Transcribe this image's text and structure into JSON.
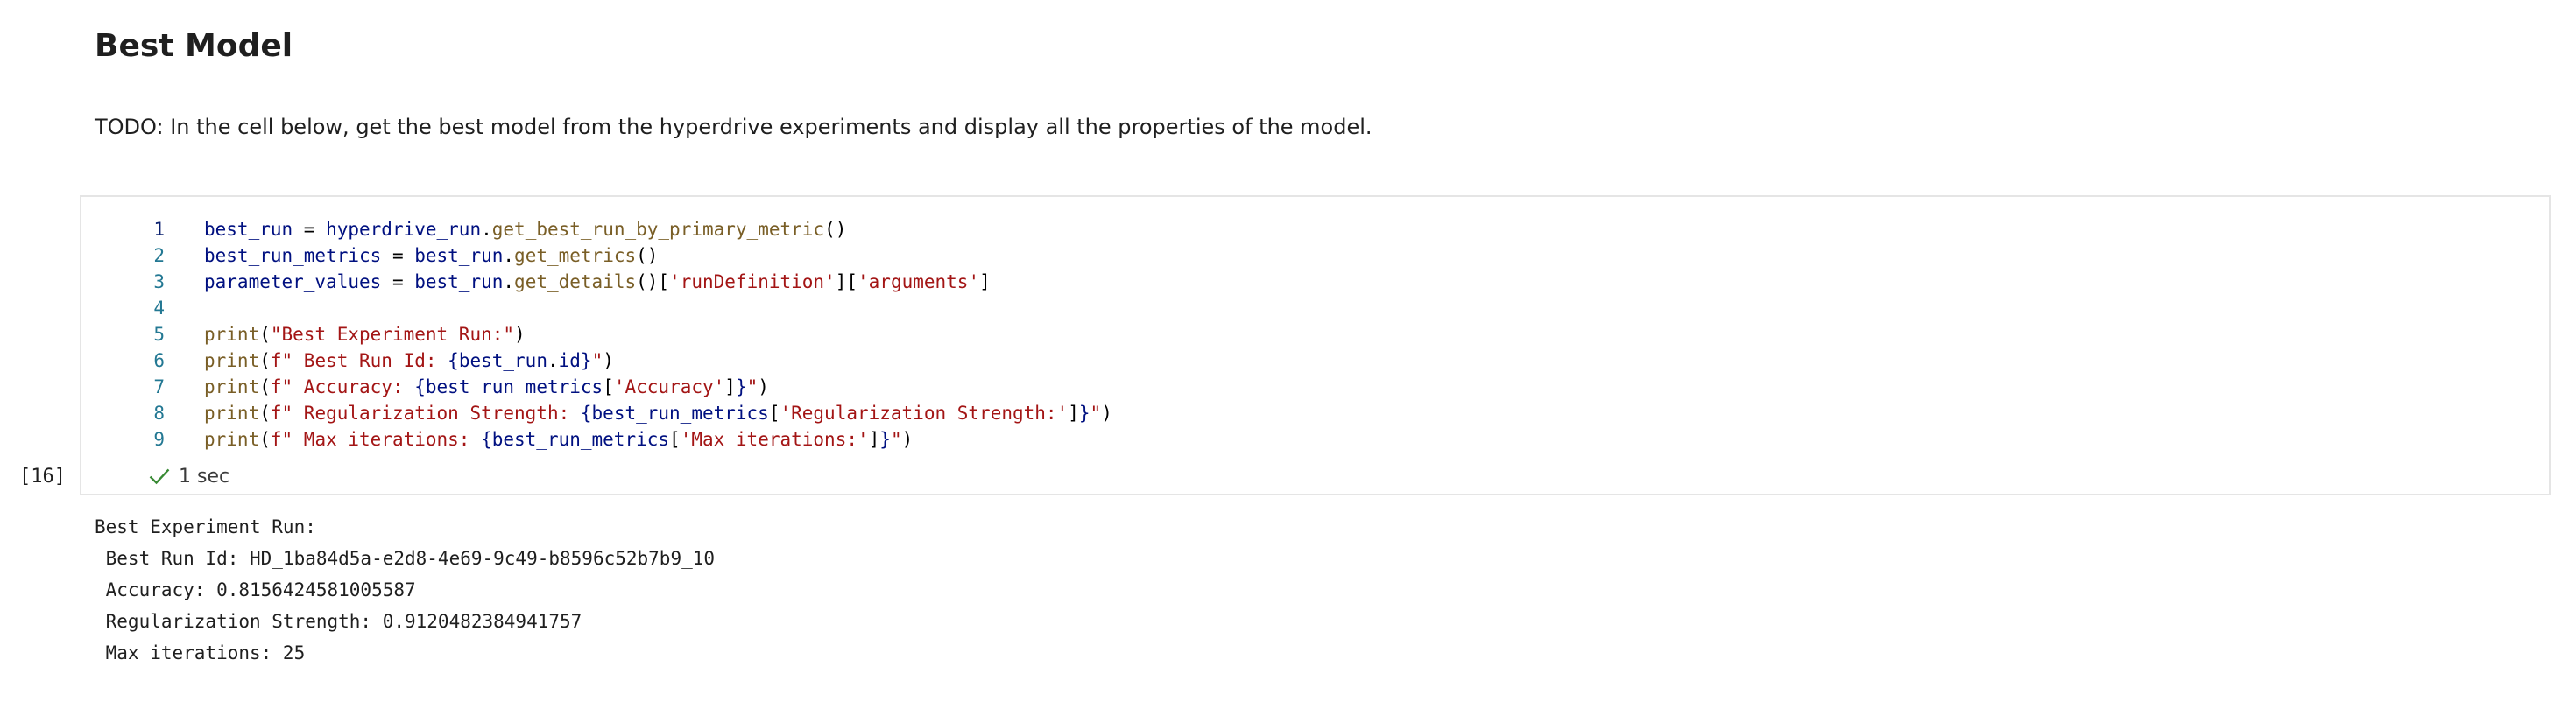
{
  "markdown": {
    "title": "Best Model",
    "text": "TODO: In the cell below, get the best model from the hyperdrive experiments and display all the properties of the model."
  },
  "code_cell": {
    "execution_count": "[16]",
    "status_text": "1 sec",
    "lines": [
      {
        "num": "1",
        "tokens": [
          {
            "t": "var",
            "v": "best_run"
          },
          {
            "t": "op",
            "v": " = "
          },
          {
            "t": "var",
            "v": "hyperdrive_run"
          },
          {
            "t": "op",
            "v": "."
          },
          {
            "t": "fn",
            "v": "get_best_run_by_primary_metric"
          },
          {
            "t": "op",
            "v": "()"
          }
        ]
      },
      {
        "num": "2",
        "tokens": [
          {
            "t": "var",
            "v": "best_run_metrics"
          },
          {
            "t": "op",
            "v": " = "
          },
          {
            "t": "var",
            "v": "best_run"
          },
          {
            "t": "op",
            "v": "."
          },
          {
            "t": "fn",
            "v": "get_metrics"
          },
          {
            "t": "op",
            "v": "()"
          }
        ]
      },
      {
        "num": "3",
        "tokens": [
          {
            "t": "var",
            "v": "parameter_values"
          },
          {
            "t": "op",
            "v": " = "
          },
          {
            "t": "var",
            "v": "best_run"
          },
          {
            "t": "op",
            "v": "."
          },
          {
            "t": "fn",
            "v": "get_details"
          },
          {
            "t": "op",
            "v": "()["
          },
          {
            "t": "str",
            "v": "'runDefinition'"
          },
          {
            "t": "op",
            "v": "]["
          },
          {
            "t": "str",
            "v": "'arguments'"
          },
          {
            "t": "op",
            "v": "]"
          }
        ]
      },
      {
        "num": "4",
        "tokens": []
      },
      {
        "num": "5",
        "tokens": [
          {
            "t": "fn",
            "v": "print"
          },
          {
            "t": "op",
            "v": "("
          },
          {
            "t": "str",
            "v": "\"Best Experiment Run:\""
          },
          {
            "t": "op",
            "v": ")"
          }
        ]
      },
      {
        "num": "6",
        "tokens": [
          {
            "t": "fn",
            "v": "print"
          },
          {
            "t": "op",
            "v": "("
          },
          {
            "t": "str",
            "v": "f\" Best Run Id: "
          },
          {
            "t": "var",
            "v": "{best_run"
          },
          {
            "t": "op",
            "v": "."
          },
          {
            "t": "var",
            "v": "id}"
          },
          {
            "t": "str",
            "v": "\""
          },
          {
            "t": "op",
            "v": ")"
          }
        ]
      },
      {
        "num": "7",
        "tokens": [
          {
            "t": "fn",
            "v": "print"
          },
          {
            "t": "op",
            "v": "("
          },
          {
            "t": "str",
            "v": "f\" Accuracy: "
          },
          {
            "t": "var",
            "v": "{best_run_metrics"
          },
          {
            "t": "op",
            "v": "["
          },
          {
            "t": "str",
            "v": "'Accuracy'"
          },
          {
            "t": "op",
            "v": "]"
          },
          {
            "t": "var",
            "v": "}"
          },
          {
            "t": "str",
            "v": "\""
          },
          {
            "t": "op",
            "v": ")"
          }
        ]
      },
      {
        "num": "8",
        "tokens": [
          {
            "t": "fn",
            "v": "print"
          },
          {
            "t": "op",
            "v": "("
          },
          {
            "t": "str",
            "v": "f\" Regularization Strength: "
          },
          {
            "t": "var",
            "v": "{best_run_metrics"
          },
          {
            "t": "op",
            "v": "["
          },
          {
            "t": "str",
            "v": "'Regularization Strength:'"
          },
          {
            "t": "op",
            "v": "]"
          },
          {
            "t": "var",
            "v": "}"
          },
          {
            "t": "str",
            "v": "\""
          },
          {
            "t": "op",
            "v": ")"
          }
        ]
      },
      {
        "num": "9",
        "tokens": [
          {
            "t": "fn",
            "v": "print"
          },
          {
            "t": "op",
            "v": "("
          },
          {
            "t": "str",
            "v": "f\" Max iterations: "
          },
          {
            "t": "var",
            "v": "{best_run_metrics"
          },
          {
            "t": "op",
            "v": "["
          },
          {
            "t": "str",
            "v": "'Max iterations:'"
          },
          {
            "t": "op",
            "v": "]"
          },
          {
            "t": "var",
            "v": "}"
          },
          {
            "t": "str",
            "v": "\""
          },
          {
            "t": "op",
            "v": ")"
          }
        ]
      }
    ]
  },
  "output": {
    "lines": [
      "Best Experiment Run:",
      " Best Run Id: HD_1ba84d5a-e2d8-4e69-9c49-b8596c52b7b9_10",
      " Accuracy: 0.8156424581005587",
      " Regularization Strength: 0.9120482384941757",
      " Max iterations: 25"
    ]
  },
  "colors": {
    "success_check": "#388a34",
    "line_number": "#237893",
    "variable": "#001080",
    "function": "#795e26",
    "string": "#a31515"
  },
  "icons": {
    "status": "check-icon"
  }
}
